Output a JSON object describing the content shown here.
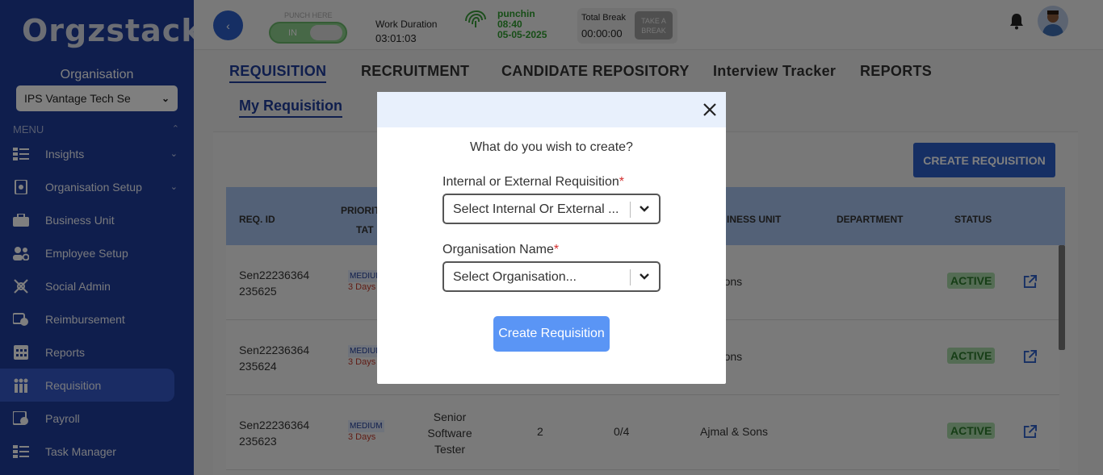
{
  "sidebar": {
    "logo": "Orgzstack",
    "org_label": "Organisation",
    "org_select_value": "IPS Vantage Tech Se",
    "menu_label": "MENU",
    "items": [
      {
        "label": "Insights",
        "icon": "insights-icon",
        "has_chevron": true
      },
      {
        "label": "Organisation Setup",
        "icon": "org-setup-icon",
        "has_chevron": true
      },
      {
        "label": "Business Unit",
        "icon": "briefcase-icon",
        "has_chevron": false
      },
      {
        "label": "Employee Setup",
        "icon": "employee-setup-icon",
        "has_chevron": false
      },
      {
        "label": "Social Admin",
        "icon": "social-admin-icon",
        "has_chevron": false
      },
      {
        "label": "Reimbursement",
        "icon": "reimbursement-icon",
        "has_chevron": false
      },
      {
        "label": "Reports",
        "icon": "reports-icon",
        "has_chevron": false
      },
      {
        "label": "Requisition",
        "icon": "requisition-icon",
        "has_chevron": false,
        "active": true
      },
      {
        "label": "Payroll",
        "icon": "payroll-icon",
        "has_chevron": false
      },
      {
        "label": "Task Manager",
        "icon": "task-manager-icon",
        "has_chevron": false
      }
    ]
  },
  "topbar": {
    "back_icon": "‹",
    "punch_label": "PUNCH HERE",
    "punch_state": "IN",
    "work_duration_label": "Work Duration",
    "work_duration_value": "03:01:03",
    "punch_status": "punchin",
    "punch_time": "08:40",
    "punch_date": "05-05-2025",
    "total_break_label": "Total Break",
    "total_break_value": "00:00:00",
    "take_break_line1": "TAKE A",
    "take_break_line2": "BREAK"
  },
  "tabs": [
    "REQUISITION",
    "RECRUITMENT",
    "CANDIDATE REPOSITORY",
    "Interview Tracker",
    "REPORTS"
  ],
  "subtab": "My Requisition",
  "create_button": "CREATE REQUISITION",
  "table": {
    "headers": {
      "req_id": "REQ. ID",
      "priority": "PRIORIT",
      "tat": "TAT",
      "business_unit": "INESS UNIT",
      "department": "DEPARTMENT",
      "status": "STATUS"
    },
    "rows": [
      {
        "id1": "Sen22236364",
        "id2": "235625",
        "priority": "MEDIUM",
        "tat": "3 Days",
        "role": [],
        "positions": "",
        "filled": "",
        "bu": "l & Sons",
        "status": "ACTIVE"
      },
      {
        "id1": "Sen22236364",
        "id2": "235624",
        "priority": "MEDIUM",
        "tat": "3 Days",
        "role": [],
        "positions": "",
        "filled": "",
        "bu": "l & Sons",
        "status": "ACTIVE"
      },
      {
        "id1": "Sen22236364",
        "id2": "235623",
        "priority": "MEDIUM",
        "tat": "3 Days",
        "role": [
          "Senior",
          "Software",
          "Tester"
        ],
        "positions": "2",
        "filled": "0/4",
        "bu": "Ajmal & Sons",
        "status": "ACTIVE"
      }
    ]
  },
  "modal": {
    "question": "What do you wish to create?",
    "field1_label": "Internal or External Requisition",
    "field1_placeholder": "Select Internal Or External ...",
    "field2_label": "Organisation Name",
    "field2_placeholder": "Select Organisation...",
    "required_mark": "*",
    "submit_label": "Create Requisition"
  },
  "colors": {
    "sidebar_bg": "#1f3d9a",
    "accent": "#2c5fc8",
    "active_status": "#2c7a2c",
    "punch_green": "#2e9c2e"
  }
}
